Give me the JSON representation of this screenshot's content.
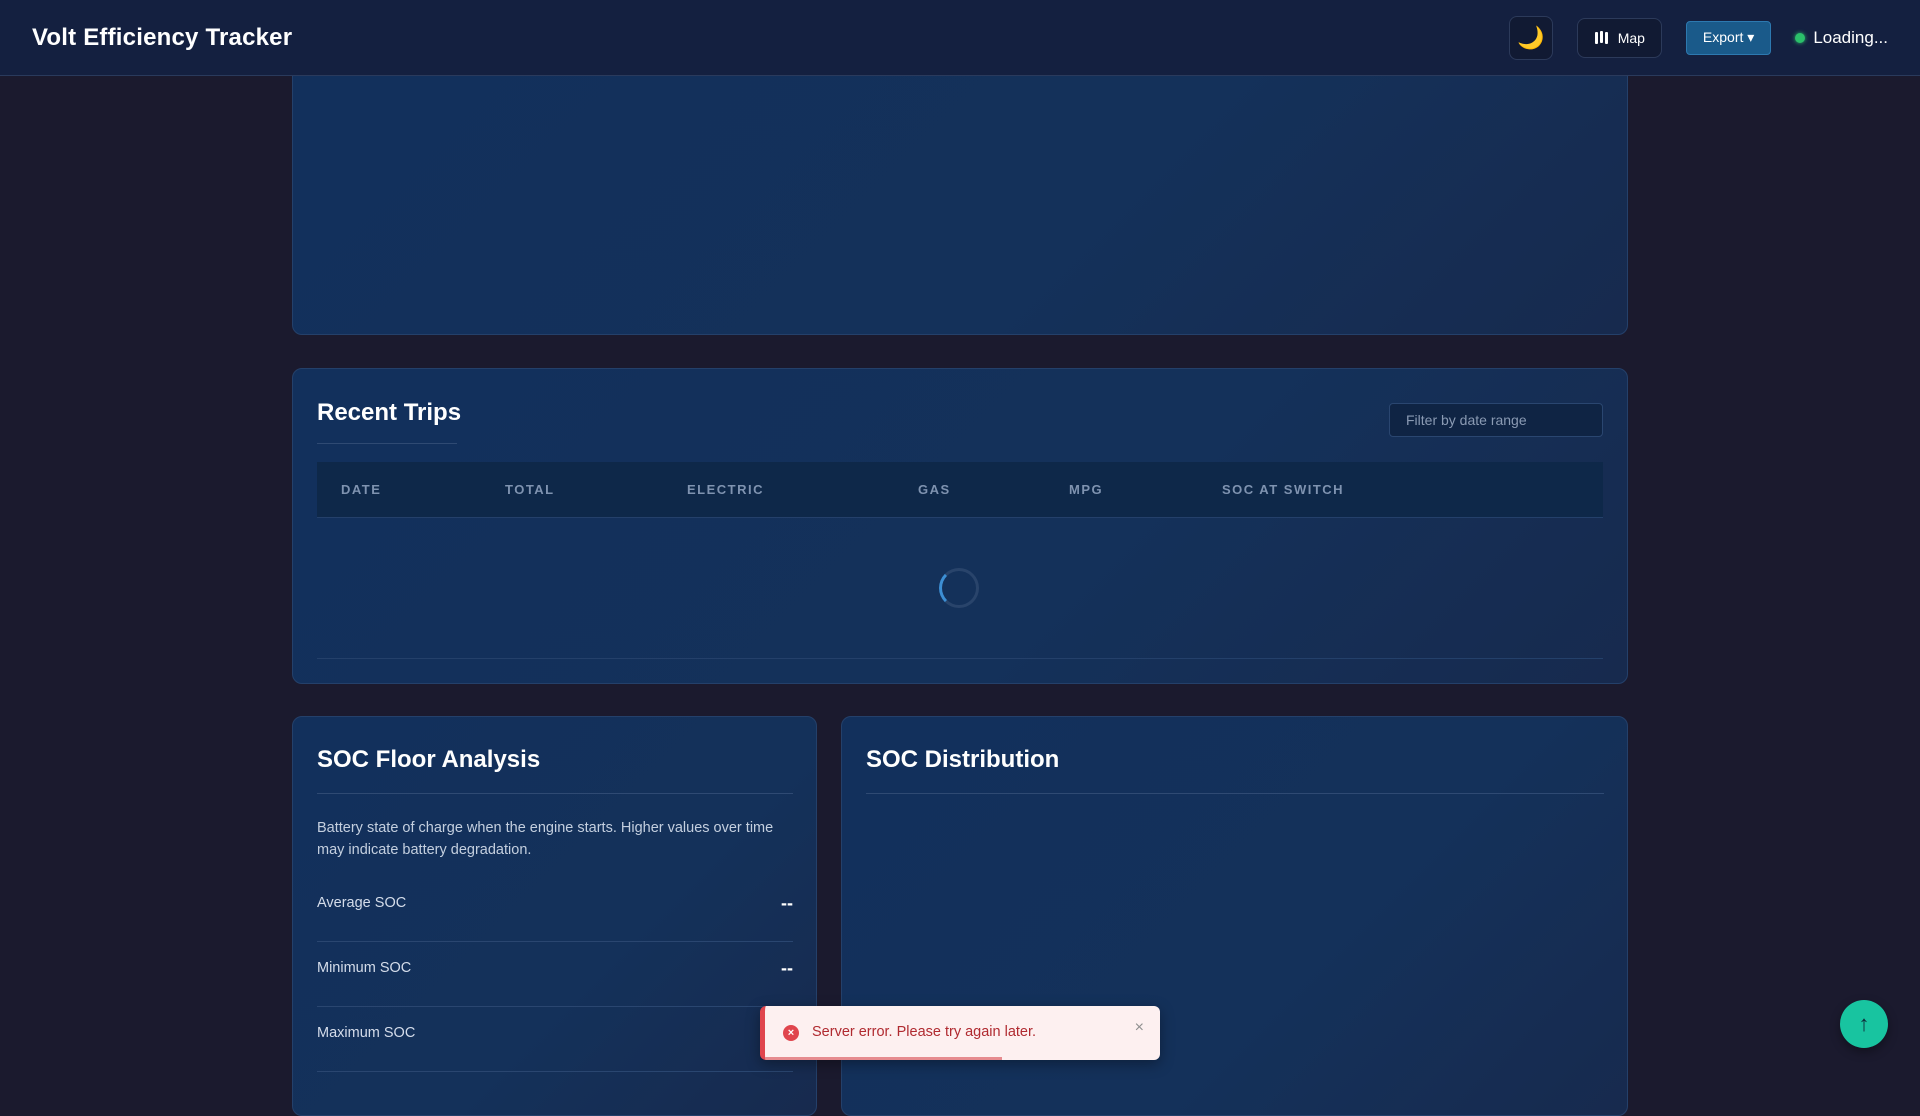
{
  "header": {
    "title": "Volt Efficiency Tracker",
    "theme_icon": "🌙",
    "map_label": "Map",
    "export_label": "Export ▾",
    "status_text": "Loading...",
    "status_color": "#2bbf6a"
  },
  "trips": {
    "heading": "Recent Trips",
    "filter_placeholder": "Filter by date range",
    "columns": [
      "DATE",
      "TOTAL",
      "ELECTRIC",
      "GAS",
      "MPG",
      "SOC AT SWITCH"
    ]
  },
  "soc_floor": {
    "heading": "SOC Floor Analysis",
    "description": "Battery state of charge when the engine starts. Higher values over time may indicate battery degradation.",
    "rows": [
      {
        "label": "Average SOC",
        "value": "--"
      },
      {
        "label": "Minimum SOC",
        "value": "--"
      },
      {
        "label": "Maximum SOC",
        "value": "--"
      }
    ]
  },
  "soc_distribution": {
    "heading": "SOC Distribution"
  },
  "toast": {
    "icon": "×",
    "message": "Server error. Please try again later.",
    "close": "×",
    "progress": 0.6
  },
  "scroll_top": {
    "icon": "↑"
  },
  "colors": {
    "accent": "#18c4a0",
    "error": "#e0454d",
    "card_bg": "#12305a"
  }
}
